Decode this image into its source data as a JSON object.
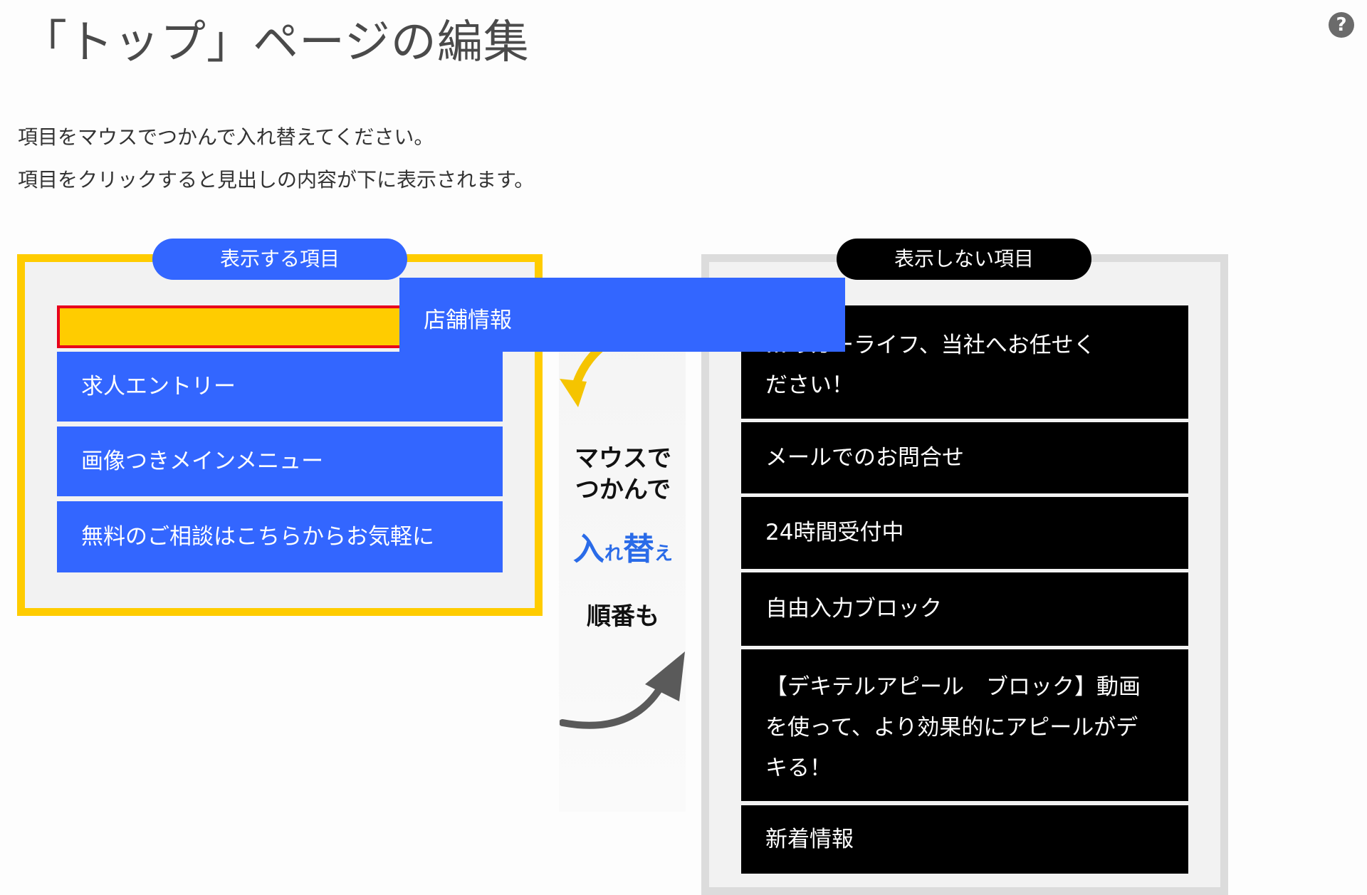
{
  "page_title": "「トップ」ページの編集",
  "instructions": [
    "項目をマウスでつかんで入れ替えてください。",
    "項目をクリックすると見出しの内容が下に表示されます。"
  ],
  "help_icon": "?",
  "shown_panel": {
    "label": "表示する項目",
    "items": [
      "求人エントリー",
      "画像つきメインメニュー",
      "無料のご相談はこちらからお気軽に"
    ]
  },
  "dragging_item": "店舗情報",
  "hint": {
    "line1": "マウスで",
    "line2": "つかんで",
    "swap_big1": "入",
    "swap_small1": "れ",
    "swap_big2": "替",
    "swap_small2": "え",
    "line3": "順番も"
  },
  "hidden_panel": {
    "label": "表示しない項目",
    "items": [
      {
        "line1": "…のカーライフ、当社へお任せく",
        "line2": "ださい！"
      },
      {
        "line1": "メールでのお問合せ"
      },
      {
        "line1": "24時間受付中"
      },
      {
        "line1": "自由入力ブロック"
      },
      {
        "line1": "【デキテルアピール　ブロック】動画",
        "line2": "を使って、より効果的にアピールがデ",
        "line3": "キる！"
      },
      {
        "line1": "新着情報"
      }
    ]
  },
  "colors": {
    "accent_blue": "#3366ff",
    "highlight_yellow": "#ffcc00",
    "drop_border_red": "#e8001c",
    "hidden_item_bg": "#000000"
  }
}
